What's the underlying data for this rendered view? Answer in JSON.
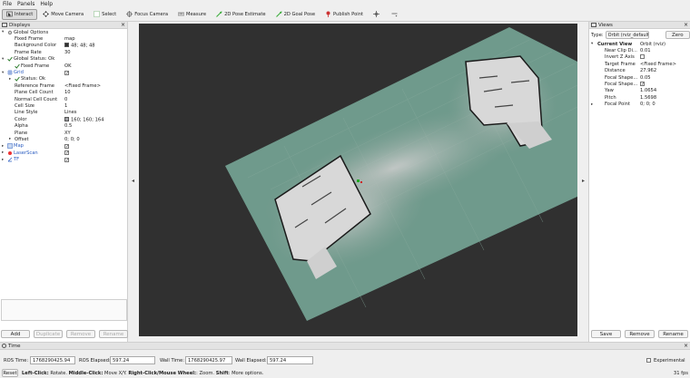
{
  "menu": [
    "File",
    "Panels",
    "Help"
  ],
  "toolbar": [
    {
      "label": "Interact",
      "icon": "cursor-icon",
      "active": true
    },
    {
      "label": "Move Camera",
      "icon": "move-camera-icon"
    },
    {
      "label": "Select",
      "icon": "select-icon"
    },
    {
      "label": "Focus Camera",
      "icon": "focus-camera-icon"
    },
    {
      "label": "Measure",
      "icon": "measure-icon"
    },
    {
      "label": "2D Pose Estimate",
      "icon": "pose-estimate-icon"
    },
    {
      "label": "2D Goal Pose",
      "icon": "goal-pose-icon"
    },
    {
      "label": "Publish Point",
      "icon": "publish-point-icon"
    },
    {
      "label": "",
      "icon": "crosshair-icon"
    },
    {
      "label": "",
      "icon": "dropdown-icon"
    }
  ],
  "displays": {
    "title": "Displays",
    "rows": [
      {
        "key": "Global Options",
        "val": "",
        "ind": 0,
        "exp": "v",
        "icon": "gear-icon"
      },
      {
        "key": "Fixed Frame",
        "val": "map",
        "ind": 1
      },
      {
        "key": "Background Color",
        "val": "48; 48; 48",
        "ind": 1,
        "swatch": "#303030"
      },
      {
        "key": "Frame Rate",
        "val": "30",
        "ind": 1
      },
      {
        "key": "Global Status: Ok",
        "val": "",
        "ind": 0,
        "exp": "v",
        "icon": "check-icon"
      },
      {
        "key": "Fixed Frame",
        "val": "OK",
        "ind": 1,
        "icon": "check-icon"
      },
      {
        "key": "Grid",
        "val": "",
        "ind": 0,
        "exp": "v",
        "icon": "grid-icon",
        "check": true,
        "blue": true
      },
      {
        "key": "Status: Ok",
        "val": "",
        "ind": 1,
        "exp": ">",
        "icon": "check-icon"
      },
      {
        "key": "Reference Frame",
        "val": "<Fixed Frame>",
        "ind": 1
      },
      {
        "key": "Plane Cell Count",
        "val": "10",
        "ind": 1
      },
      {
        "key": "Normal Cell Count",
        "val": "0",
        "ind": 1
      },
      {
        "key": "Cell Size",
        "val": "1",
        "ind": 1
      },
      {
        "key": "Line Style",
        "val": "Lines",
        "ind": 1
      },
      {
        "key": "Color",
        "val": "160; 160; 164",
        "ind": 1,
        "swatch": "#a0a0a4"
      },
      {
        "key": "Alpha",
        "val": "0.5",
        "ind": 1
      },
      {
        "key": "Plane",
        "val": "XY",
        "ind": 1
      },
      {
        "key": "Offset",
        "val": "0; 0; 0",
        "ind": 1,
        "exp": ">"
      },
      {
        "key": "Map",
        "val": "",
        "ind": 0,
        "exp": ">",
        "icon": "map-icon",
        "check": true,
        "blue": true
      },
      {
        "key": "LaserScan",
        "val": "",
        "ind": 0,
        "exp": ">",
        "icon": "laser-icon",
        "check": true,
        "blue": true
      },
      {
        "key": "TF",
        "val": "",
        "ind": 0,
        "exp": ">",
        "icon": "tf-icon",
        "check": true,
        "blue": true
      }
    ],
    "buttons": [
      "Add",
      "Duplicate",
      "Remove",
      "Rename"
    ]
  },
  "views": {
    "title": "Views",
    "type_label": "Type:",
    "type_value": "Orbit (rviz_default_",
    "zero": "Zero",
    "rows": [
      {
        "key": "Current View",
        "val": "Orbit (rviz)",
        "bold": true,
        "exp": "v"
      },
      {
        "key": "Near Clip Di...",
        "val": "0.01"
      },
      {
        "key": "Invert Z Axis",
        "val": "",
        "check": true
      },
      {
        "key": "Target Frame",
        "val": "<Fixed Frame>"
      },
      {
        "key": "Distance",
        "val": "27.962"
      },
      {
        "key": "Focal Shape...",
        "val": "0.05"
      },
      {
        "key": "Focal Shape...",
        "val": "✓",
        "check": true
      },
      {
        "key": "Yaw",
        "val": "1.0654"
      },
      {
        "key": "Pitch",
        "val": "1.5698"
      },
      {
        "key": "Focal Point",
        "val": "0; 0; 0",
        "exp": ">"
      }
    ],
    "buttons": [
      "Save",
      "Remove",
      "Rename"
    ]
  },
  "time": {
    "title": "Time",
    "ros_time_label": "ROS Time:",
    "ros_time": "1768290425.94",
    "ros_elapsed_label": "ROS Elapsed:",
    "ros_elapsed": "597.24",
    "wall_time_label": "Wall Time:",
    "wall_time": "1768290425.97",
    "wall_elapsed_label": "Wall Elapsed:",
    "wall_elapsed": "597.24",
    "experimental": "Experimental"
  },
  "status": {
    "reset": "Reset",
    "hint_a": "Left-Click:",
    "hint_a2": " Rotate. ",
    "hint_b": "Middle-Click:",
    "hint_b2": " Move X/Y. ",
    "hint_c": "Right-Click/Mouse Wheel:",
    "hint_c2": ": Zoom. ",
    "hint_d": "Shift",
    "hint_d2": ": More options.",
    "fps": "31 fps"
  },
  "colors": {
    "viewport_bg": "#303030",
    "grid_teal": "#6f9a8c",
    "map_free": "#d8d8d8",
    "link_blue": "#2a5cc0"
  }
}
